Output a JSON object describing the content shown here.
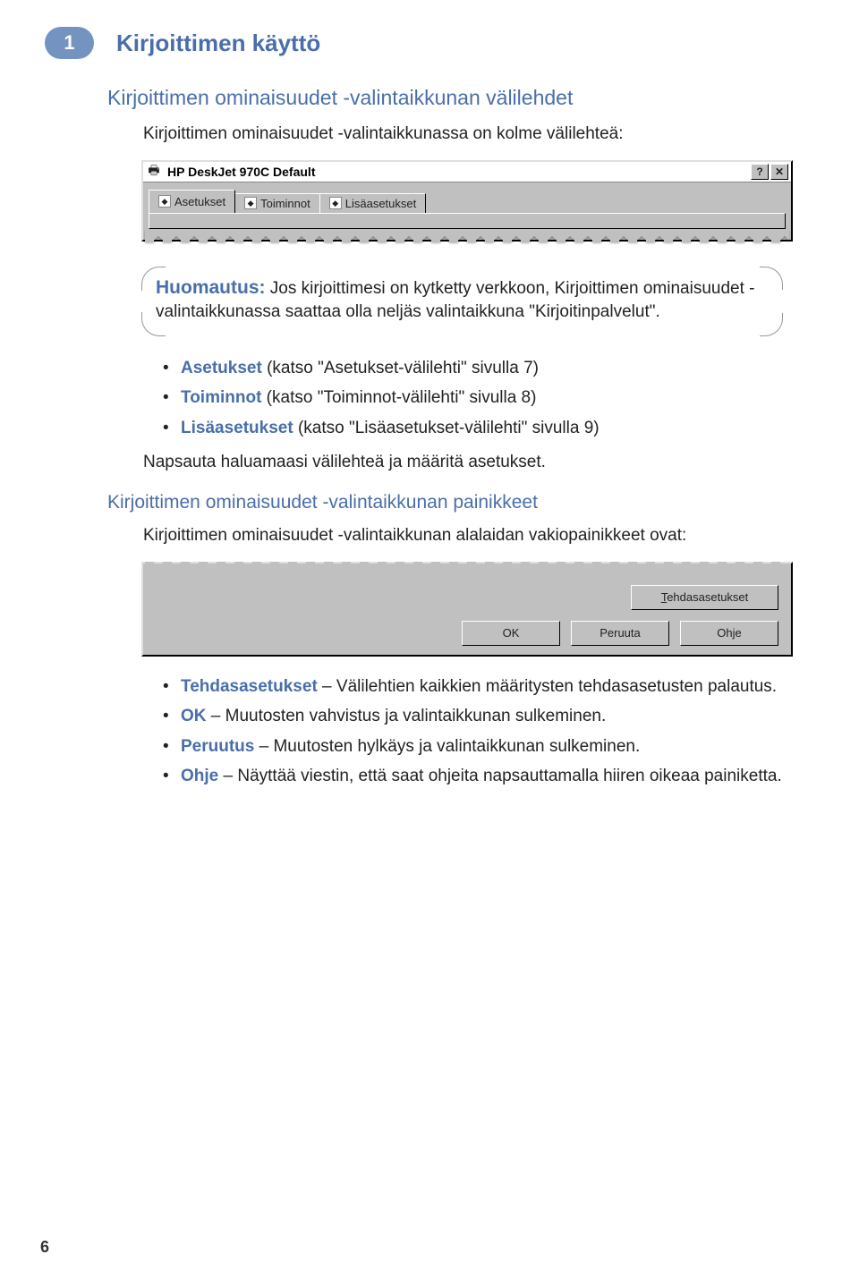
{
  "chapter": {
    "number": "1",
    "title": "Kirjoittimen käyttö"
  },
  "headings": {
    "h2": "Kirjoittimen ominaisuudet -valintaikkunan välilehdet",
    "intro": "Kirjoittimen ominaisuudet -valintaikkunassa on kolme välilehteä:",
    "h3": "Kirjoittimen ominaisuudet -valintaikkunan painikkeet",
    "intro2": "Kirjoittimen ominaisuudet -valintaikkunan alalaidan vakiopainikkeet ovat:"
  },
  "window1": {
    "title": "HP DeskJet 970C Default",
    "help": "?",
    "close": "✕",
    "tabs": [
      "Asetukset",
      "Toiminnot",
      "Lisäasetukset"
    ]
  },
  "note": {
    "label": "Huomautus:",
    "text": " Jos kirjoittimesi on kytketty verkkoon, Kirjoittimen ominaisuudet -valintaikkunassa saattaa olla neljäs valintaikkuna \"Kirjoitinpalvelut\"."
  },
  "list1": [
    {
      "kw": "Asetukset",
      "rest": " (katso \"Asetukset-välilehti\" sivulla 7)"
    },
    {
      "kw": "Toiminnot",
      "rest": " (katso \"Toiminnot-välilehti\" sivulla 8)"
    },
    {
      "kw": "Lisäasetukset",
      "rest": " (katso \"Lisäasetukset-välilehti\" sivulla 9)"
    }
  ],
  "after_list1": "Napsauta haluamaasi välilehteä ja määritä asetukset.",
  "window2": {
    "buttons": {
      "factory_u": "T",
      "factory_rest": "ehdasasetukset",
      "ok": "OK",
      "cancel": "Peruuta",
      "help": "Ohje"
    }
  },
  "list2": [
    {
      "kw": "Tehdasasetukset",
      "rest": " – Välilehtien kaikkien määritysten tehdasasetusten palautus."
    },
    {
      "kw": "OK",
      "rest": " – Muutosten vahvistus ja valintaikkunan sulkeminen."
    },
    {
      "kw": "Peruutus",
      "rest": " – Muutosten hylkäys ja valintaikkunan sulkeminen."
    },
    {
      "kw": "Ohje",
      "rest": " – Näyttää viestin, että saat ohjeita napsauttamalla hiiren oikeaa painiketta."
    }
  ],
  "page_number": "6"
}
